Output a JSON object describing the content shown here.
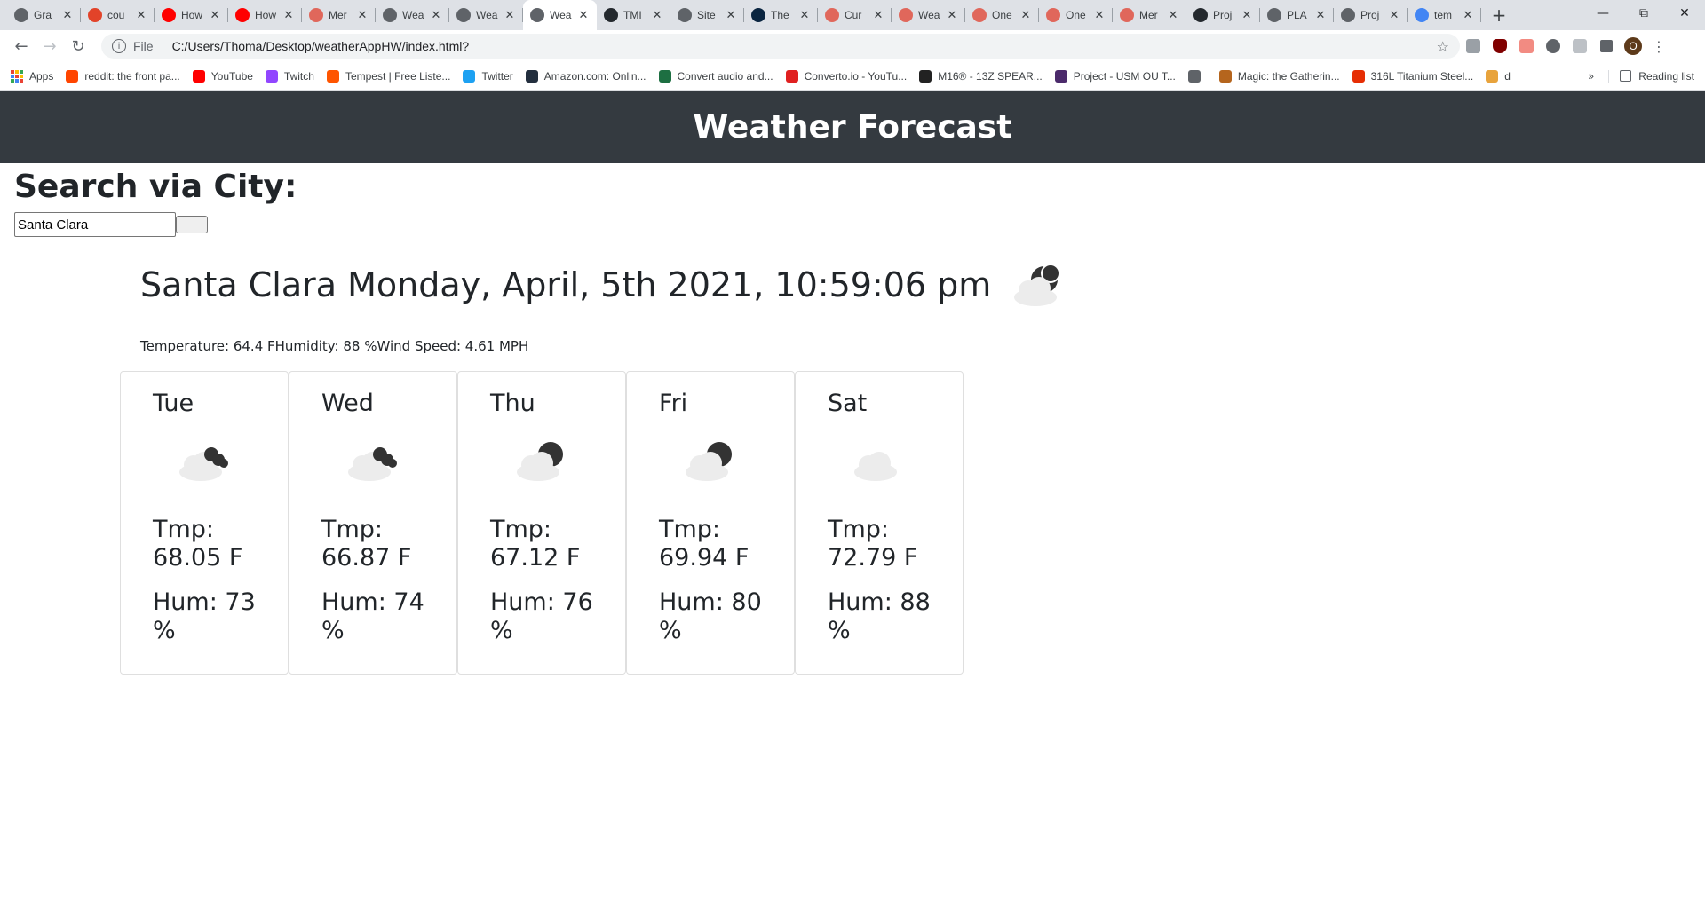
{
  "browser": {
    "tabs": [
      {
        "title": "Gra",
        "favicon": "globe-icon",
        "color": "#5f6368"
      },
      {
        "title": "cou",
        "favicon": "gitlab-icon",
        "color": "#e24329"
      },
      {
        "title": "How",
        "favicon": "youtube-icon",
        "color": "#ff0000"
      },
      {
        "title": "How",
        "favicon": "youtube-icon",
        "color": "#ff0000"
      },
      {
        "title": "Mer",
        "favicon": "brain-icon",
        "color": "#e0675b"
      },
      {
        "title": "Wea",
        "favicon": "globe-icon",
        "color": "#5f6368"
      },
      {
        "title": "Wea",
        "favicon": "globe-icon",
        "color": "#5f6368"
      },
      {
        "title": "Wea",
        "favicon": "globe-icon",
        "color": "#5f6368",
        "active": true
      },
      {
        "title": "TMI",
        "favicon": "github-icon",
        "color": "#24292e"
      },
      {
        "title": "Site",
        "favicon": "globe-icon",
        "color": "#5f6368"
      },
      {
        "title": "The",
        "favicon": "square-icon",
        "color": "#0a2540"
      },
      {
        "title": "Cur",
        "favicon": "brain-icon",
        "color": "#e0675b"
      },
      {
        "title": "Wea",
        "favicon": "brain-icon",
        "color": "#e0675b"
      },
      {
        "title": "One",
        "favicon": "brain-icon",
        "color": "#e0675b"
      },
      {
        "title": "One",
        "favicon": "brain-icon",
        "color": "#e0675b"
      },
      {
        "title": "Mer",
        "favicon": "brain-icon",
        "color": "#e0675b"
      },
      {
        "title": "Proj",
        "favicon": "github-icon",
        "color": "#24292e"
      },
      {
        "title": "PLA",
        "favicon": "globe-icon",
        "color": "#5f6368"
      },
      {
        "title": "Proj",
        "favicon": "globe-icon",
        "color": "#5f6368"
      },
      {
        "title": "tem",
        "favicon": "google-icon",
        "color": "#4285f4"
      }
    ],
    "omnibox": {
      "scheme": "File",
      "url": "C:/Users/Thoma/Desktop/weatherAppHW/index.html?"
    },
    "profile_initial": "O",
    "bookmarks": [
      {
        "label": "Apps",
        "color": ""
      },
      {
        "label": "reddit: the front pa...",
        "color": "#ff4500"
      },
      {
        "label": "YouTube",
        "color": "#ff0000"
      },
      {
        "label": "Twitch",
        "color": "#9146ff"
      },
      {
        "label": "Tempest | Free Liste...",
        "color": "#ff5500"
      },
      {
        "label": "Twitter",
        "color": "#1da1f2"
      },
      {
        "label": "Amazon.com: Onlin...",
        "color": "#232f3e"
      },
      {
        "label": "Convert audio and...",
        "color": "#1d6f42"
      },
      {
        "label": "Converto.io - YouTu...",
        "color": "#e02020"
      },
      {
        "label": "M16® - 13Z SPEAR...",
        "color": "#222222"
      },
      {
        "label": "Project - USM OU T...",
        "color": "#4b2a6b"
      },
      {
        "label": "",
        "color": "#5f6368"
      },
      {
        "label": "Magic: the Gatherin...",
        "color": "#b5651d"
      },
      {
        "label": "316L Titanium Steel...",
        "color": "#e62e04"
      },
      {
        "label": "d",
        "color": "#e8a33c"
      }
    ],
    "bookmarks_more": "»",
    "reading_list": "Reading list"
  },
  "app": {
    "header": "Weather Forecast",
    "search_title": "Search via City:",
    "search_value": "Santa Clara",
    "current": {
      "title": "Santa Clara Monday, April, 5th 2021, 10:59:06 pm",
      "icon": "moon-cloud-icon",
      "stats": "Temperature: 64.4 FHumidity: 88 %Wind Speed: 4.61 MPH"
    },
    "forecast": [
      {
        "day": "Tue",
        "icon": "broken-clouds-icon",
        "temp": "Tmp: 68.05 F",
        "hum": "Hum: 73 %"
      },
      {
        "day": "Wed",
        "icon": "broken-clouds-icon",
        "temp": "Tmp: 66.87 F",
        "hum": "Hum: 74 %"
      },
      {
        "day": "Thu",
        "icon": "moon-cloud-icon",
        "temp": "Tmp: 67.12 F",
        "hum": "Hum: 76 %"
      },
      {
        "day": "Fri",
        "icon": "moon-cloud-icon",
        "temp": "Tmp: 69.94 F",
        "hum": "Hum: 80 %"
      },
      {
        "day": "Sat",
        "icon": "cloud-icon",
        "temp": "Tmp: 72.79 F",
        "hum": "Hum: 88 %"
      }
    ]
  }
}
